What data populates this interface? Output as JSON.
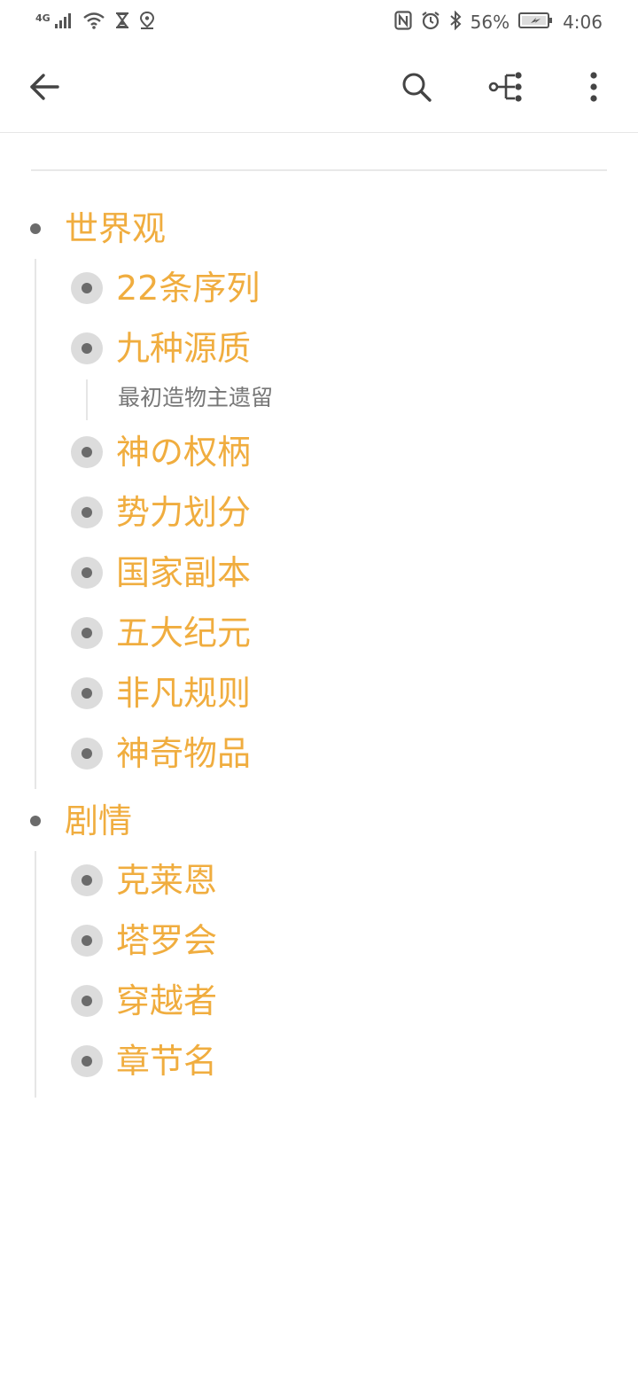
{
  "status_bar": {
    "network_label": "4G",
    "battery": "56%",
    "time": "4:06",
    "left_icons": [
      "signal-icon",
      "wifi-icon",
      "hourglass-icon",
      "location-icon"
    ],
    "right_icons": [
      "nfc-icon",
      "alarm-icon",
      "bluetooth-icon",
      "battery-icon"
    ]
  },
  "toolbar": {
    "icons": [
      "back-arrow-icon",
      "search-icon",
      "mindmap-icon",
      "more-vertical-icon"
    ]
  },
  "colors": {
    "accent": "#f0ad3f",
    "bullet": "#6b6b6b",
    "bullet_ring": "#dcdcdc",
    "divider": "#e6e6e6"
  },
  "outline": {
    "sections": [
      {
        "title": "世界观",
        "children": [
          {
            "title": "22条序列"
          },
          {
            "title": "九种源质",
            "note": "最初造物主遗留"
          },
          {
            "title": "神の权柄"
          },
          {
            "title": "势力划分"
          },
          {
            "title": "国家副本"
          },
          {
            "title": "五大纪元"
          },
          {
            "title": "非凡规则"
          },
          {
            "title": "神奇物品"
          }
        ]
      },
      {
        "title": "剧情",
        "children": [
          {
            "title": "克莱恩"
          },
          {
            "title": "塔罗会"
          },
          {
            "title": "穿越者"
          },
          {
            "title": "章节名"
          }
        ]
      }
    ]
  }
}
